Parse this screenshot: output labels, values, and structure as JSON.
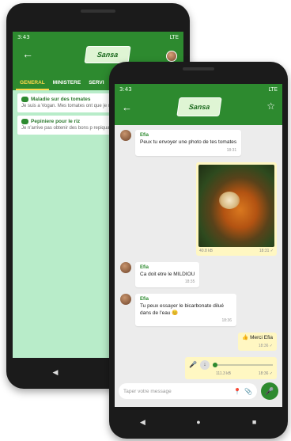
{
  "back_phone": {
    "status": {
      "time": "3:43",
      "signal": "LTE"
    },
    "tabs": [
      "GENERAL",
      "MINISTERE",
      "SERVI"
    ],
    "topics": [
      {
        "title": "Maladie sur des tomates",
        "desc": "Je suis a Vogan. Mes tomates ont que je ne connais pas"
      },
      {
        "title": "Pepiniere pour le riz",
        "desc": "Je n'arrive pas obtenir des bons p repiquage"
      }
    ]
  },
  "front_phone": {
    "status": {
      "time": "3:43",
      "signal": "LTE"
    },
    "messages": {
      "m1": {
        "sender": "Efia",
        "text": "Peux tu envoyer une photo de tes tomates",
        "time": "18:31"
      },
      "photo": {
        "size": "40.8 kB",
        "time": "18:31 ✓"
      },
      "m2": {
        "sender": "Efia",
        "text": "Ca doit etre le MILDIOU",
        "time": "18:35"
      },
      "m3": {
        "sender": "Efia",
        "text": "Tu peux essayer le bicarbonate dilué dans de l'eau 😊",
        "time": "18:36"
      },
      "m4": {
        "text": "👍 Merci Efia",
        "time": "18:36 ✓"
      },
      "voice": {
        "size": "111.3 kB",
        "time": "18:36 ✓"
      }
    },
    "composer": {
      "placeholder": "Taper votre message"
    }
  },
  "icons": {
    "back": "←",
    "star": "☆",
    "pin": "📍",
    "clip": "📎",
    "mic": "🎤",
    "nav_back": "◀",
    "nav_home": "●",
    "nav_recent": "■"
  },
  "colors": {
    "primary": "#2d8a2f",
    "accent": "#ffd84a",
    "outgoing": "#fff7c2",
    "list_bg": "#b8ecc9"
  },
  "logo_text": "Sansa"
}
